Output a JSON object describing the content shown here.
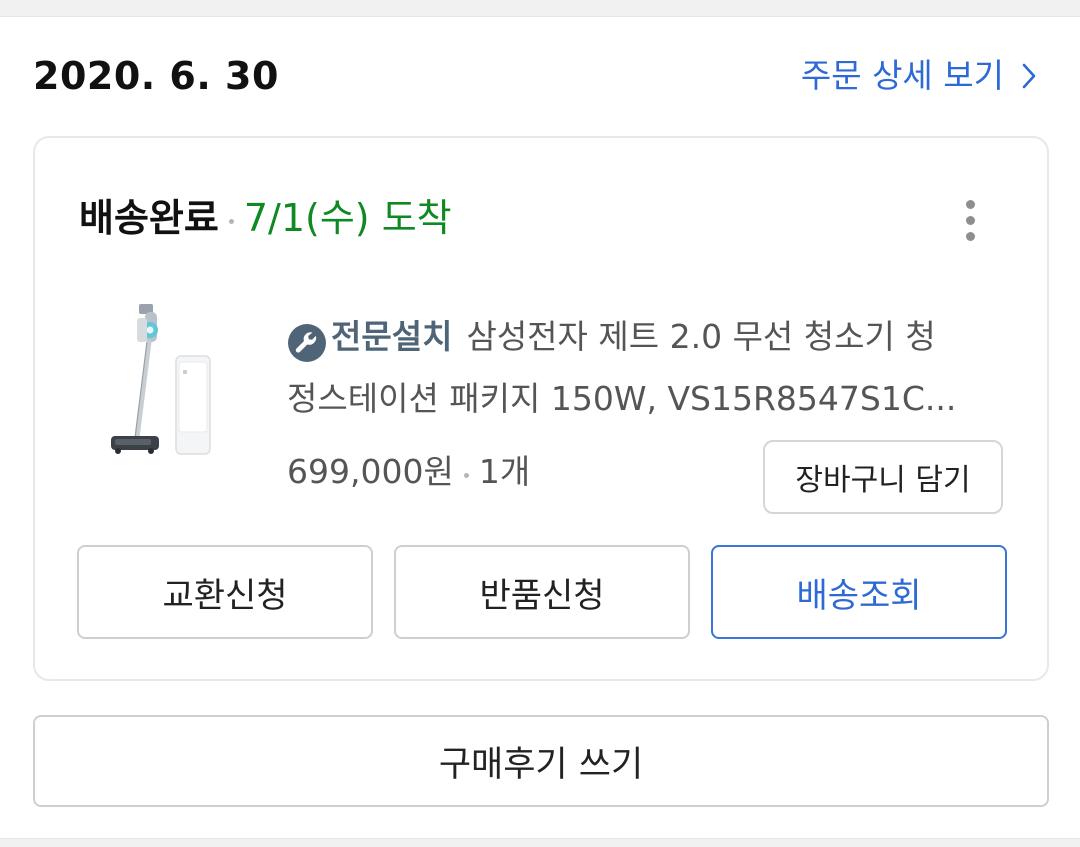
{
  "order": {
    "date": "2020. 6. 30",
    "detail_link_label": "주문 상세 보기",
    "detail_link_icon": "chevron-right-icon"
  },
  "status": {
    "label": "배송완료",
    "arrival": "7/1(수) 도착",
    "arrival_color": "#0f8a23",
    "more_icon": "more-vertical-icon"
  },
  "product": {
    "badge_icon": "wrench-icon",
    "badge_label": "전문설치",
    "title_line1": "삼성전자 제트 2.0 무선 청소기 청",
    "title_line2": "정스테이션 패키지 150W, VS15R8547S1C...",
    "price": "699,000원",
    "quantity": "1개",
    "cart_button": "장바구니 담기",
    "image_icon": "vacuum-cleaner-product-image"
  },
  "actions": {
    "exchange": "교환신청",
    "return": "반품신청",
    "track": "배송조회"
  },
  "review_button": "구매후기 쓰기",
  "colors": {
    "link_blue": "#2d6ad6",
    "status_green": "#0f8a23",
    "badge_slate": "#4f6577"
  }
}
